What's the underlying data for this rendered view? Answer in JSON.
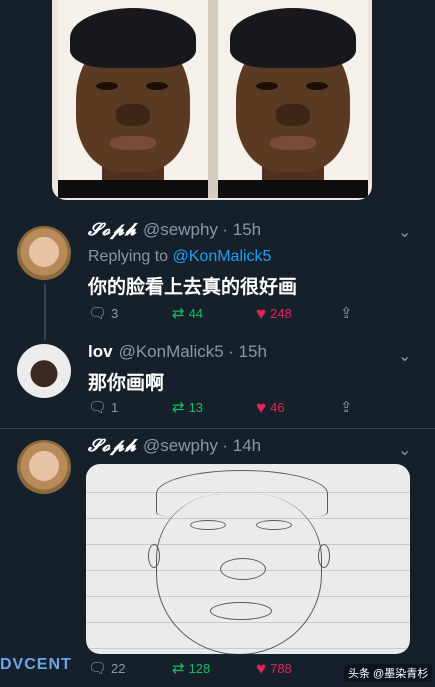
{
  "tweets": [
    {
      "name": "𝓢𝓸𝓹𝓱",
      "handle": "@sewphy",
      "time": "· 15h",
      "reply_prefix": "Replying to ",
      "reply_handle": "@KonMalick5",
      "text": "你的脸看上去真的很好画",
      "replies": "3",
      "retweets": "44",
      "likes": "248"
    },
    {
      "name": "lov",
      "handle": "@KonMalick5",
      "time": "· 15h",
      "text": "那你画啊",
      "replies": "1",
      "retweets": "13",
      "likes": "46"
    },
    {
      "name": "𝓢𝓸𝓹𝓱",
      "handle": "@sewphy",
      "time": "· 14h",
      "replies": "22",
      "retweets": "128",
      "likes": "788"
    }
  ],
  "icons": {
    "reply": "reply-icon",
    "retweet": "retweet-icon",
    "like": "heart-icon",
    "share": "share-icon",
    "more": "chevron-down-icon"
  },
  "colors": {
    "background": "#15202b",
    "link": "#1da1f2",
    "retweet": "#17bf63",
    "like": "#e0245e",
    "muted": "#8899a6"
  },
  "watermark": {
    "left": "DVCENT",
    "right": "头条 @墨染青杉"
  }
}
